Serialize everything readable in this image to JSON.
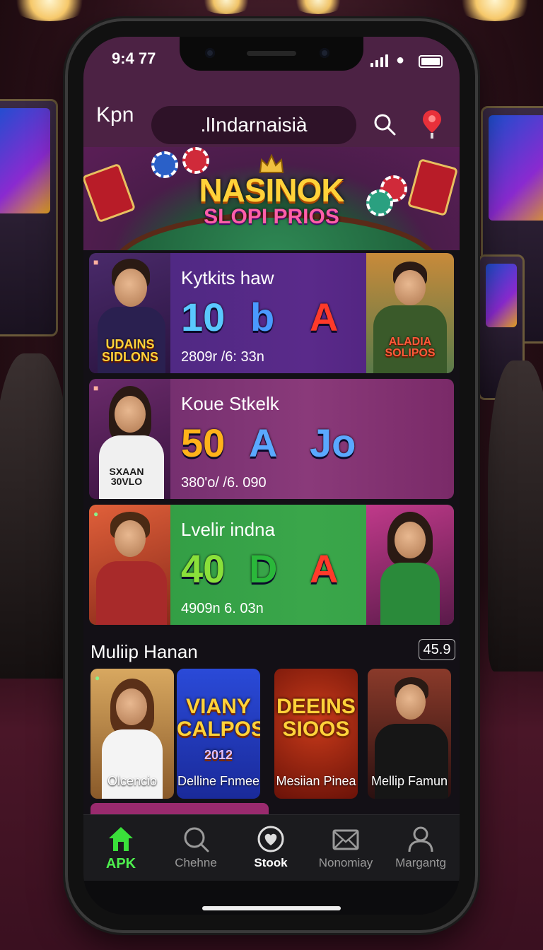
{
  "status_bar": {
    "time": "9:4 77"
  },
  "header": {
    "app_name": "Kpn",
    "search_text": ".lIndarnaisià"
  },
  "banner": {
    "title": "NASINOK",
    "subtitle": "SLOPI PRIOS"
  },
  "promos": [
    {
      "heading": "Kytkits haw",
      "symbols": [
        "10",
        "b",
        "A"
      ],
      "stat": "2809r /6: 33n",
      "left_label": "UDAINS SIDLONS",
      "right_label": "ALADIA SOLIPOS"
    },
    {
      "heading": "Koue Stkelk",
      "symbols": [
        "50",
        "A",
        "Jo"
      ],
      "stat": "380'o/ /6. 090",
      "left_label": "SXAAN 30VLO"
    },
    {
      "heading": "Lvelir indna",
      "symbols": [
        "40",
        "D",
        "A"
      ],
      "stat": "4909n 6. 03n"
    }
  ],
  "section": {
    "title": "Muliip Hanan",
    "badge": "45.9"
  },
  "games": [
    {
      "name": "Olcencio"
    },
    {
      "name": "Delline Fnmee",
      "logo": "VIANY CALPOS",
      "logo_sub": "2012"
    },
    {
      "name": "Mesiian Pinea",
      "logo": "DEEINS SIOOS"
    },
    {
      "name": "Mellip Famun"
    }
  ],
  "nav": [
    {
      "label": "APK",
      "icon": "home-icon"
    },
    {
      "label": "Chehne",
      "icon": "search-icon"
    },
    {
      "label": "Stook",
      "icon": "heart-icon"
    },
    {
      "label": "Nonomiay",
      "icon": "mail-icon"
    },
    {
      "label": "Margantg",
      "icon": "profile-icon"
    }
  ],
  "colors": {
    "header_bg": "#4c2244",
    "active_nav": "#4ef04e",
    "nav_bg": "#1b1b1e",
    "promo1_bg": "#5a2a8a",
    "promo2_bg": "#8a3a7a",
    "promo3_bg": "#3aa64a",
    "gold_text": "#ffd23a"
  }
}
